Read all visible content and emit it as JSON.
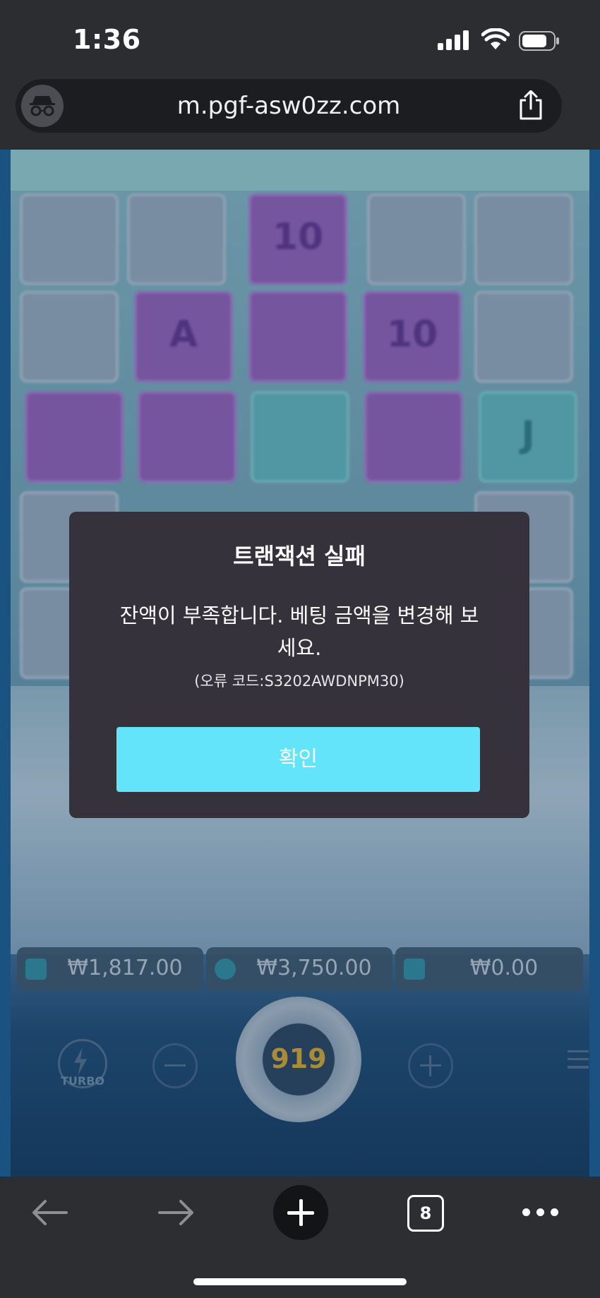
{
  "status_bar": {
    "time": "1:36",
    "battery_level": 0.7
  },
  "browser": {
    "url": "m.pgf-asw0zz.com",
    "icons": {
      "left": "incognito-icon",
      "right": "share-icon"
    }
  },
  "game": {
    "balance": "₩1,817.00",
    "bet": "₩3,750.00",
    "win": "₩0.00",
    "turbo_label": "TURBO",
    "spin_counter": "919",
    "tile_symbols": [
      "10",
      "A",
      "10",
      "J"
    ]
  },
  "dialog": {
    "title": "트랜잭션 실패",
    "message": "잔액이 부족합니다. 베팅 금액을 변경해 보세요.",
    "error_code": "(오류 코드:S3202AWDNPM30)",
    "confirm_label": "확인",
    "confirm_color": "#63e4fb"
  },
  "toolbar": {
    "tab_count": "8"
  }
}
